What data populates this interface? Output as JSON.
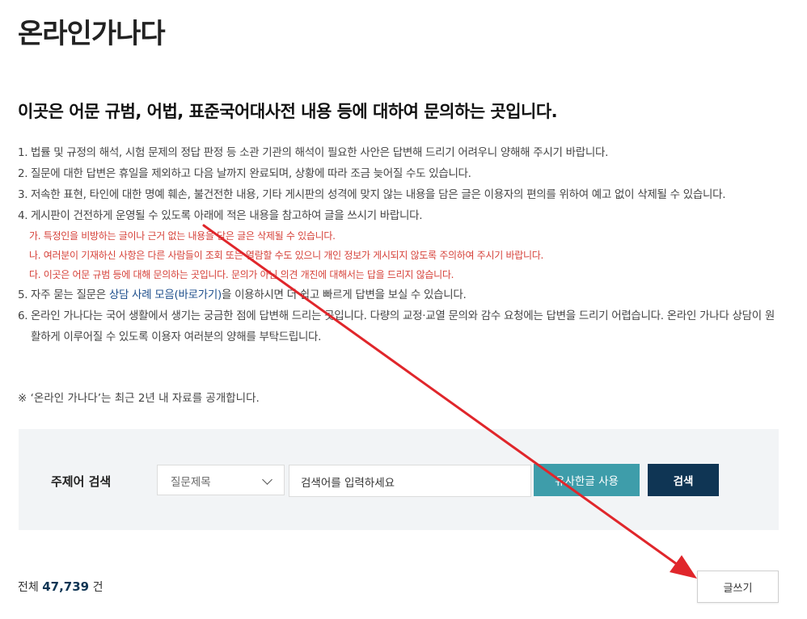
{
  "page": {
    "title": "온라인가나다",
    "intro_heading": "이곳은 어문 규범, 어법, 표준국어대사전 내용 등에 대하여 문의하는 곳입니다."
  },
  "rules": [
    {
      "num": "1.",
      "text": "법률 및 규정의 해석, 시험 문제의 정답 판정 등 소관 기관의 해석이 필요한 사안은 답변해 드리기 어려우니 양해해 주시기 바랍니다."
    },
    {
      "num": "2.",
      "text": "질문에 대한 답변은 휴일을 제외하고 다음 날까지 완료되며, 상황에 따라 조금 늦어질 수도 있습니다."
    },
    {
      "num": "3.",
      "text": "저속한 표현, 타인에 대한 명예 훼손, 불건전한 내용, 기타 게시판의 성격에 맞지 않는 내용을 담은 글은 이용자의 편의를 위하여 예고 없이 삭제될 수 있습니다."
    },
    {
      "num": "4.",
      "text": "게시판이 건전하게 운영될 수 있도록 아래에 적은 내용을 참고하여 글을 쓰시기 바랍니다."
    },
    {
      "num": "5.",
      "text_before": "자주 묻는 질문은 ",
      "link": "상담 사례 모음(바로가기)",
      "text_after": "을 이용하시면 더 쉽고 빠르게 답변을 보실 수 있습니다."
    },
    {
      "num": "6.",
      "text": "온라인 가나다는 국어 생활에서 생기는 궁금한 점에 답변해 드리는 곳입니다. 다량의 교정·교열 문의와 감수 요청에는 답변을 드리기 어렵습니다. 온라인 가나다 상담이 원활하게 이루어질 수 있도록 이용자 여러분의 양해를 부탁드립니다."
    }
  ],
  "sub_rules": [
    "가. 특정인을 비방하는 글이나 근거 없는 내용을 담은 글은 삭제될 수 있습니다.",
    "나. 여러분이 기재하신 사항은 다른 사람들이 조회 또는 열람할 수도 있으니 개인 정보가 게시되지 않도록 주의하여 주시기 바랍니다.",
    "다. 이곳은 어문 규범 등에 대해 문의하는 곳입니다. 문의가 아닌 의견 개진에 대해서는 답을 드리지 않습니다."
  ],
  "notice": "※ ‘온라인 가나다’는 최근 2년 내 자료를 공개합니다.",
  "search": {
    "label": "주제어 검색",
    "select_value": "질문제목",
    "input_value": "검색어를 입력하세요",
    "similar_button": "유사한글 사용",
    "search_button": "검색"
  },
  "list": {
    "total_prefix": "전체",
    "total_count": "47,739",
    "total_suffix": "건",
    "write_button": "글쓰기"
  },
  "colors": {
    "arrow": "#e0262b",
    "accent_teal": "#3e9daa",
    "accent_navy": "#0f3554",
    "warning_red": "#d6423a"
  }
}
